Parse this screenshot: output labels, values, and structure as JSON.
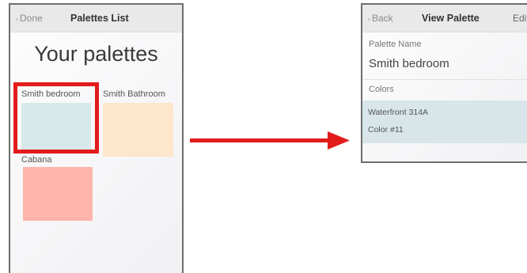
{
  "left_screen": {
    "nav": {
      "back_label": "Done",
      "title": "Palettes List"
    },
    "heading": "Your palettes",
    "palettes": [
      {
        "name": "Smith bedroom",
        "color": "#d8e9e9",
        "highlighted": true
      },
      {
        "name": "Smith Bathroom",
        "color": "#fde6cb",
        "highlighted": false
      },
      {
        "name": "Cabana",
        "color": "#fdb4ab",
        "highlighted": false
      }
    ],
    "highlight_color": "#e21b1b"
  },
  "right_screen": {
    "nav": {
      "back_label": "Back",
      "title": "View Palette",
      "action_label": "Edit"
    },
    "palette_name_label": "Palette Name",
    "palette_name_value": "Smith bedroom",
    "colors_label": "Colors",
    "colors": [
      {
        "name": "Waterfront 314A",
        "subtitle": "Color #11",
        "swatch": "#d8e6ea"
      }
    ]
  },
  "arrow_color": "#e21b1b"
}
